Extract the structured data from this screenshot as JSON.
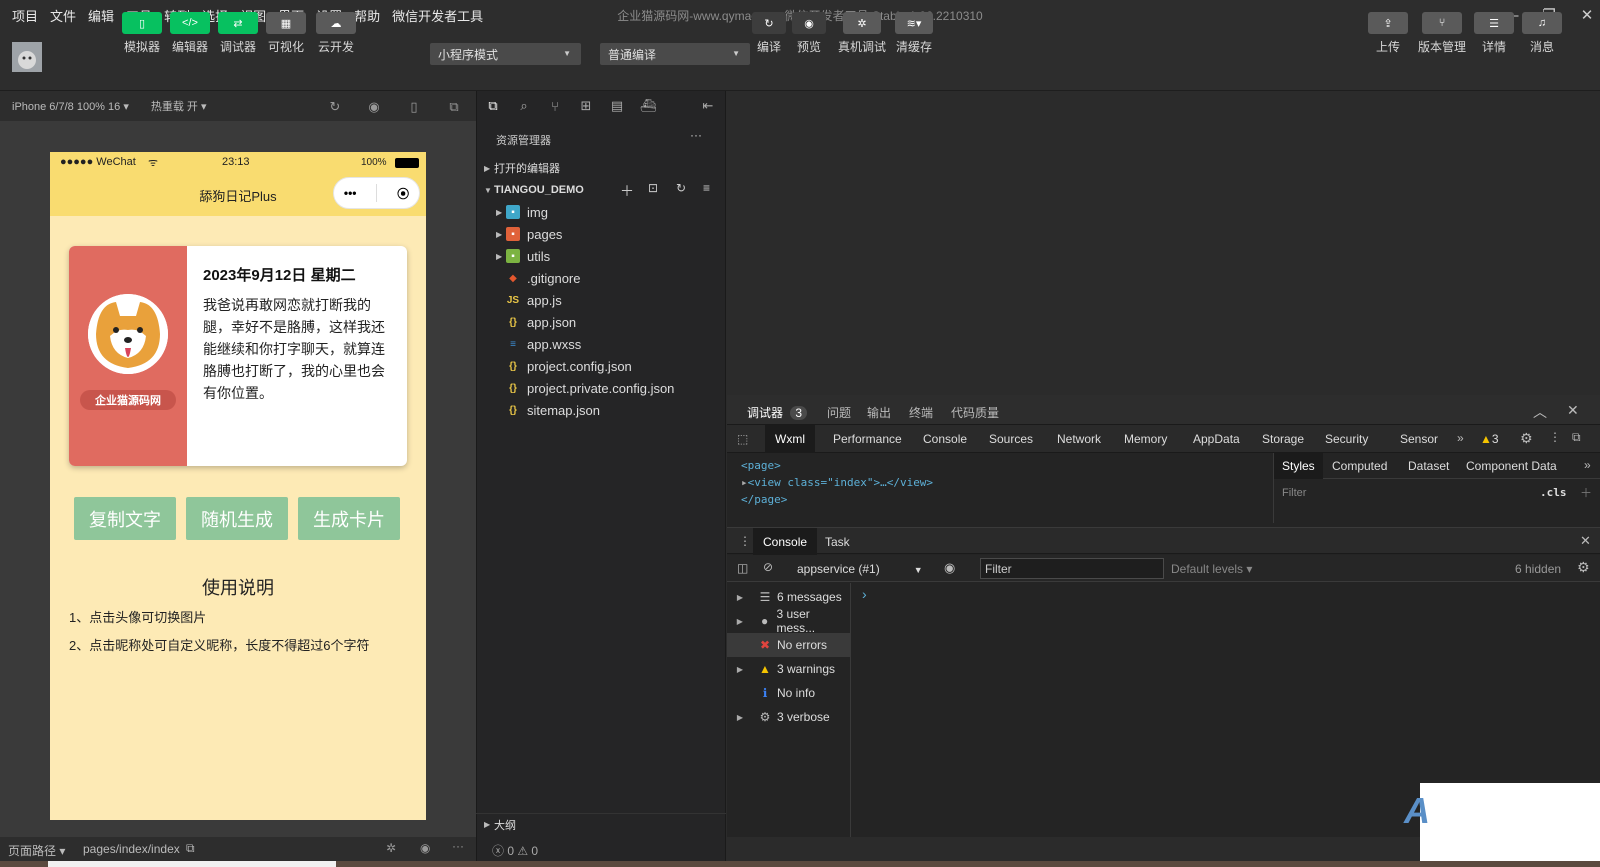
{
  "menu": [
    "项目",
    "文件",
    "编辑",
    "工具",
    "转到",
    "选择",
    "视图",
    "界面",
    "设置",
    "帮助",
    "微信开发者工具"
  ],
  "window_title": "企业猫源码网-www.qymao.cn - 微信开发者工具 Stable 1.06.2210310",
  "toolbar": {
    "buttons": [
      {
        "label": "模拟器"
      },
      {
        "label": "编辑器"
      },
      {
        "label": "调试器"
      },
      {
        "label": "可视化"
      },
      {
        "label": "云开发"
      }
    ],
    "mode_select": "小程序模式",
    "compile_select": "普通编译",
    "actions": [
      {
        "label": "编译"
      },
      {
        "label": "预览"
      },
      {
        "label": "真机调试"
      },
      {
        "label": "清缓存"
      }
    ],
    "right_actions": [
      {
        "label": "上传"
      },
      {
        "label": "版本管理"
      },
      {
        "label": "详情"
      },
      {
        "label": "消息"
      }
    ]
  },
  "simulator": {
    "device": "iPhone 6/7/8 100% 16",
    "hot_reload": "热重载 开",
    "status": {
      "carrier": "●●●●● WeChat",
      "time": "23:13",
      "battery": "100%"
    },
    "nav_title": "舔狗日记Plus",
    "card": {
      "badge": "企业猫源码网",
      "date": "2023年9月12日 星期二",
      "text": "我爸说再敢网恋就打断我的腿，幸好不是胳膊，这样我还能继续和你打字聊天，就算连胳膊也打断了，我的心里也会有你位置。"
    },
    "buttons": [
      "复制文字",
      "随机生成",
      "生成卡片"
    ],
    "usage_title": "使用说明",
    "notes": [
      "1、点击头像可切换图片",
      "2、点击昵称处可自定义昵称，长度不得超过6个字符"
    ],
    "footer_path_label": "页面路径",
    "footer_path": "pages/index/index"
  },
  "explorer": {
    "title": "资源管理器",
    "open_editors": "打开的编辑器",
    "project": "TIANGOU_DEMO",
    "items": [
      {
        "name": "img",
        "type": "folder",
        "color": "#3fa7c9"
      },
      {
        "name": "pages",
        "type": "folder",
        "color": "#e0623a"
      },
      {
        "name": "utils",
        "type": "folder",
        "color": "#7cb342"
      },
      {
        "name": ".gitignore",
        "type": "git",
        "color": "#e4572e"
      },
      {
        "name": "app.js",
        "type": "js",
        "color": "#e8c547"
      },
      {
        "name": "app.json",
        "type": "json",
        "color": "#e8c547"
      },
      {
        "name": "app.wxss",
        "type": "css",
        "color": "#3d8fd6"
      },
      {
        "name": "project.config.json",
        "type": "json",
        "color": "#e8c547"
      },
      {
        "name": "project.private.config.json",
        "type": "json",
        "color": "#e8c547"
      },
      {
        "name": "sitemap.json",
        "type": "json",
        "color": "#e8c547"
      }
    ],
    "outline": "大纲",
    "status": "ⓧ 0 ⚠ 0"
  },
  "devtools": {
    "top_tabs": [
      {
        "label": "调试器",
        "badge": "3"
      },
      {
        "label": "问题"
      },
      {
        "label": "输出"
      },
      {
        "label": "终端"
      },
      {
        "label": "代码质量"
      }
    ],
    "panel_tabs": [
      "Wxml",
      "Performance",
      "Console",
      "Sources",
      "Network",
      "Memory",
      "AppData",
      "Storage",
      "Security",
      "Sensor"
    ],
    "warn_count": "3",
    "wxml": [
      "<page>",
      "<view class=\"index\">…</view>",
      "</page>"
    ],
    "style_tabs": [
      "Styles",
      "Computed",
      "Dataset",
      "Component Data"
    ],
    "filter_placeholder": "Filter",
    "cls": ".cls",
    "drawer_tabs": [
      "Console",
      "Task"
    ],
    "context": "appservice (#1)",
    "console_filter": "Filter",
    "levels": "Default levels",
    "hidden": "6 hidden",
    "sidebar": [
      {
        "label": "6 messages",
        "icon": "list-icon",
        "color": "#bbb"
      },
      {
        "label": "3 user mess...",
        "icon": "user-icon",
        "color": "#bbb"
      },
      {
        "label": "No errors",
        "icon": "error-icon",
        "color": "#e0443e"
      },
      {
        "label": "3 warnings",
        "icon": "warning-icon",
        "color": "#f5c400"
      },
      {
        "label": "No info",
        "icon": "info-icon",
        "color": "#3b82f6"
      },
      {
        "label": "3 verbose",
        "icon": "gear-icon",
        "color": "#bbb"
      }
    ],
    "prompt": "›"
  }
}
